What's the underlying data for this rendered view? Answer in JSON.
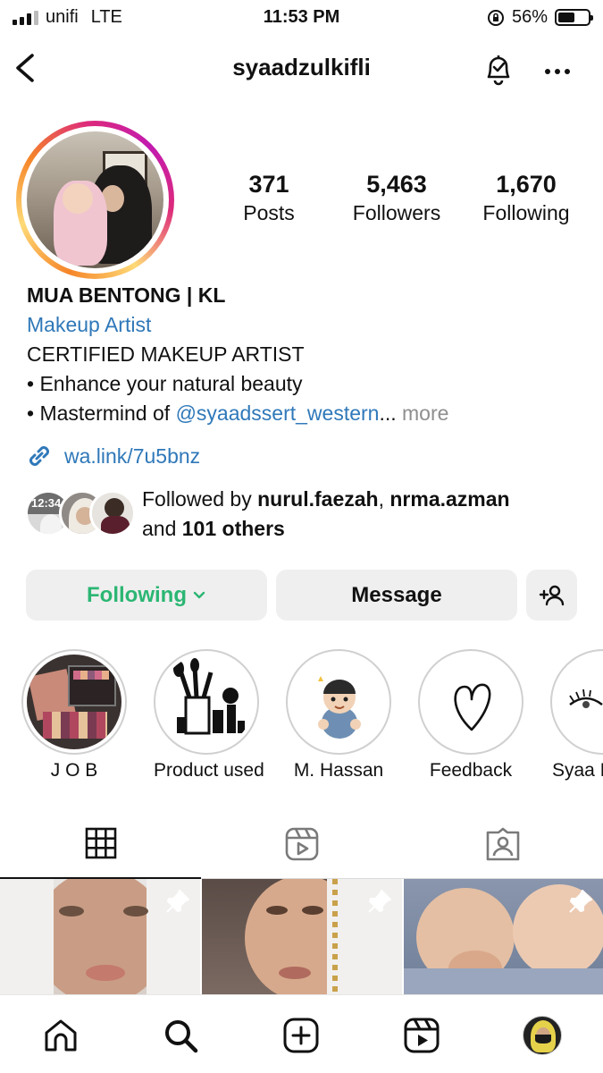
{
  "status_bar": {
    "carrier": "unifi",
    "network": "LTE",
    "time": "11:53 PM",
    "battery": "56%",
    "battery_level": 0.56
  },
  "header": {
    "username": "syaadzulkifli",
    "icons": [
      "back-chevron-icon",
      "notification-bell-icon",
      "more-options-icon"
    ]
  },
  "stats": [
    {
      "value": "371",
      "label": "Posts"
    },
    {
      "value": "5,463",
      "label": "Followers"
    },
    {
      "value": "1,670",
      "label": "Following"
    }
  ],
  "bio": {
    "name": "MUA BENTONG | KL",
    "category": "Makeup Artist",
    "line1": "CERTIFIED MAKEUP ARTIST",
    "line2": "• Enhance your natural beauty",
    "line3_prefix": "• Mastermind of ",
    "line3_mention": "@syaadssert_western",
    "line3_ellipsis": "...",
    "more": "more",
    "link": "wa.link/7u5bnz"
  },
  "followed_by": {
    "prefix": "Followed by ",
    "user1": "nurul.faezah",
    "sep": ", ",
    "user2": "nrma.azman",
    "line2_prefix": "and ",
    "others": "101 others",
    "mini_avatar_time": "12:34"
  },
  "buttons": {
    "following": "Following",
    "message": "Message",
    "following_color": "#2bb673"
  },
  "highlights": [
    {
      "label": "J O B"
    },
    {
      "label": "Product used"
    },
    {
      "label": "M. Hassan"
    },
    {
      "label": "Feedback"
    },
    {
      "label": "Syaa M"
    }
  ],
  "tabs": [
    "grid-icon",
    "reels-icon",
    "tagged-icon"
  ],
  "bottom_nav": [
    "home-icon",
    "search-icon",
    "create-icon",
    "reels-icon",
    "profile-avatar"
  ]
}
